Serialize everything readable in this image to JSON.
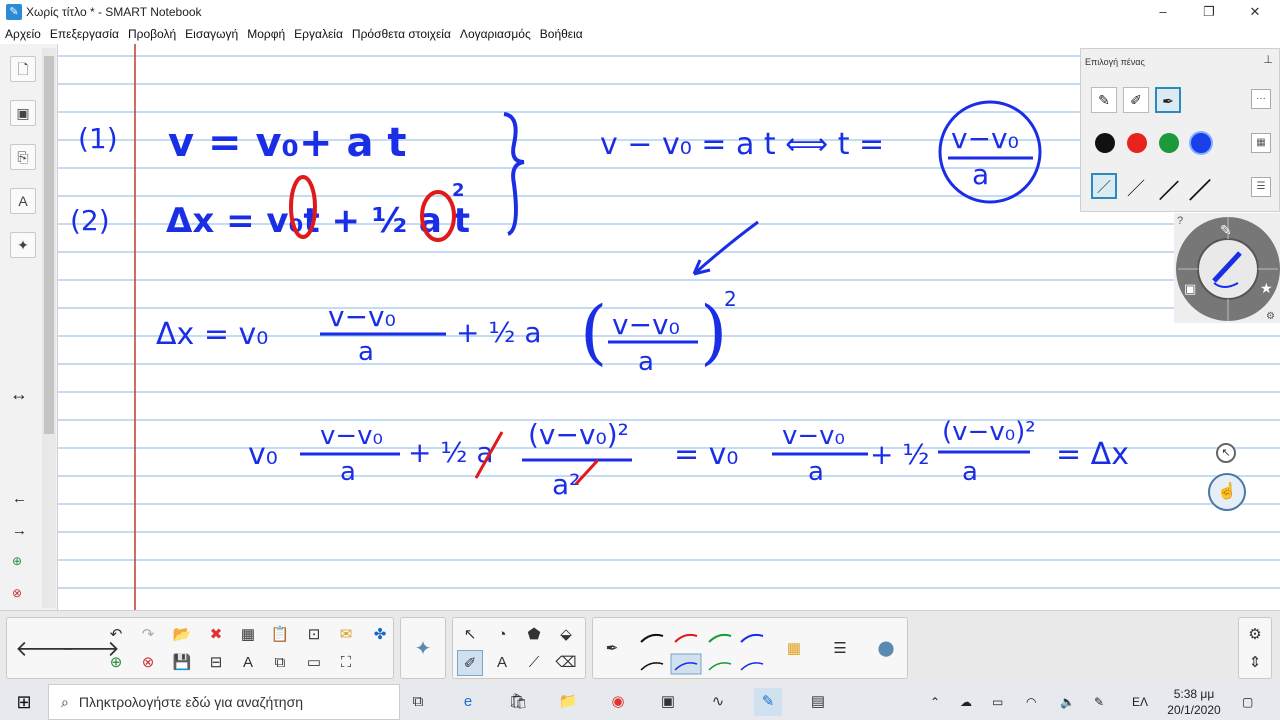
{
  "window": {
    "title": "Χωρίς τίτλο * - SMART Notebook",
    "minimize": "–",
    "restore": "❐",
    "close": "✕"
  },
  "menu": [
    "Αρχείο",
    "Επεξεργασία",
    "Προβολή",
    "Εισαγωγή",
    "Μορφή",
    "Εργαλεία",
    "Πρόσθετα στοιχεία",
    "Λογαριασμός",
    "Βοήθεια"
  ],
  "pen_panel": {
    "title": "Επιλογή πένας",
    "colors": [
      "#111111",
      "#e8231d",
      "#1a9a3a",
      "#1a3ee8"
    ],
    "selected_color": "#1a3ee8"
  },
  "search": {
    "placeholder": "Πληκτρολογήστε εδώ για αναζήτηση"
  },
  "tray": {
    "language": "ΕΛ",
    "time": "5:38 μμ",
    "date": "20/1/2020"
  },
  "handwriting": {
    "eq1_label": "(1)",
    "eq2_label": "(2)",
    "eq1": "v = v₀ + a t",
    "eq2": "Δx = v₀t + ½ a t²",
    "solve_t": "v − v₀ = a t ⟺ t = (v − v₀)/a",
    "line3": "Δx = v₀ (v − v₀)/a + ½ a ((v − v₀)/a)²",
    "line4": "v₀ (v − v₀)/a + ½ a (v − v₀)²/a² = v₀ (v − v₀)/a + ½ (v − v₀)²/a = Δx"
  },
  "colors": {
    "ink": "#1a2ee6",
    "mark": "#e01a1a",
    "rule": "#9fc6ee",
    "margin": "#c8433a"
  }
}
